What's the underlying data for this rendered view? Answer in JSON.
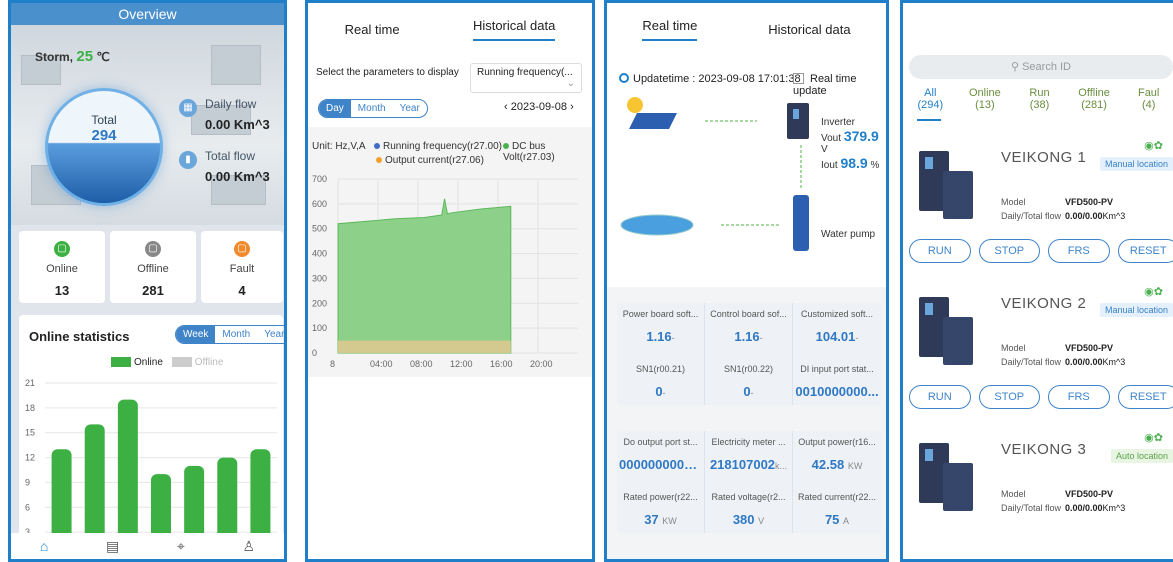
{
  "overview": {
    "title": "Overview",
    "weather": {
      "city": "Storm,",
      "temp": "25",
      "unit": "℃"
    },
    "total": {
      "label": "Total",
      "value": "294"
    },
    "daily_flow": {
      "label": "Daily flow",
      "value": "0.00 Km^3"
    },
    "total_flow": {
      "label": "Total flow",
      "value": "0.00 Km^3"
    },
    "stats": [
      {
        "label": "Online",
        "value": "13",
        "color": "#3cb043"
      },
      {
        "label": "Offline",
        "value": "281",
        "color": "#888888"
      },
      {
        "label": "Fault",
        "value": "4",
        "color": "#f08a2c"
      }
    ],
    "online_stats": {
      "title": "Online statistics",
      "ranges": [
        "Week",
        "Month",
        "Year"
      ],
      "legend": {
        "online": "Online",
        "offline": "Offline"
      },
      "chart_data": {
        "type": "bar",
        "values": [
          13,
          16,
          19,
          10,
          11,
          12,
          13
        ],
        "yticks": [
          "21",
          "18",
          "15",
          "12",
          "9",
          "6",
          "3"
        ],
        "ylim": [
          0,
          21
        ],
        "series": [
          {
            "name": "Online",
            "values": [
              13,
              16,
              19,
              10,
              11,
              12,
              13
            ]
          }
        ],
        "color": "#3cb043"
      }
    }
  },
  "historical": {
    "tabs": [
      "Real time",
      "Historical data"
    ],
    "select_label": "Select the parameters to display",
    "select_value": "Running frequency(...",
    "ranges": [
      "Day",
      "Month",
      "Year"
    ],
    "date": "2023-09-08",
    "unit": "Unit: Hz,V,A",
    "legend": [
      {
        "label": "Running frequency(r27.00)",
        "color": "#3f6cc9"
      },
      {
        "label": "DC bus Volt(r27.03)",
        "color": "#4cb050"
      },
      {
        "label": "Output current(r27.06)",
        "color": "#f0a02c"
      }
    ],
    "chart_data": {
      "type": "area",
      "xticks": [
        "8",
        "04:00",
        "08:00",
        "12:00",
        "16:00",
        "20:00"
      ],
      "yticks": [
        "700",
        "600",
        "500",
        "400",
        "300",
        "200",
        "100",
        "0"
      ],
      "ylim": [
        0,
        700
      ],
      "series": [
        {
          "name": "DC bus Volt(r27.03)",
          "x": [
            0,
            1,
            2,
            3,
            3.6,
            3.7,
            3.8,
            4,
            5,
            6
          ],
          "values": [
            520,
            530,
            540,
            545,
            555,
            620,
            560,
            565,
            580,
            590
          ]
        },
        {
          "name": "Output current(r27.06)",
          "x": [
            0,
            6
          ],
          "values": [
            50,
            50
          ]
        }
      ]
    }
  },
  "realtime": {
    "tabs": [
      "Real time",
      "Historical data"
    ],
    "updatetime": "Updatetime : 2023-09-08 17:01:38",
    "realtime_update": "Real time update",
    "inverter": {
      "label": "Inverter",
      "vout_label": "Vout",
      "vout": "379.9",
      "vout_unit": "V",
      "iout_label": "Iout",
      "iout": "98.9",
      "iout_unit": "%"
    },
    "pump_label": "Water pump",
    "params": [
      {
        "k": "Power board soft...",
        "v": "1.16",
        "u": "-"
      },
      {
        "k": "Control board sof...",
        "v": "1.16",
        "u": "-"
      },
      {
        "k": "Customized soft...",
        "v": "104.01",
        "u": "-"
      },
      {
        "k": "SN1(r00.21)",
        "v": "0",
        "u": "-"
      },
      {
        "k": "SN1(r00.22)",
        "v": "0",
        "u": "-"
      },
      {
        "k": "DI input port stat...",
        "v": "0010000000...",
        "u": ""
      },
      {
        "k": "Do output port st...",
        "v": "0000000000...",
        "u": ""
      },
      {
        "k": "Electricity meter ...",
        "v": "218107002",
        "u": "k..."
      },
      {
        "k": "Output power(r16...",
        "v": "42.58",
        "u": "KW"
      },
      {
        "k": "Rated power(r22...",
        "v": "37",
        "u": "KW"
      },
      {
        "k": "Rated voltage(r2...",
        "v": "380",
        "u": "V"
      },
      {
        "k": "Rated current(r22...",
        "v": "75",
        "u": "A"
      }
    ]
  },
  "devices": {
    "search_placeholder": "Search ID",
    "filters": [
      {
        "label": "All",
        "count": "(294)"
      },
      {
        "label": "Online",
        "count": "(13)"
      },
      {
        "label": "Run",
        "count": "(38)"
      },
      {
        "label": "Offline",
        "count": "(281)"
      },
      {
        "label": "Faul",
        "count": "(4)"
      }
    ],
    "model_label": "Model",
    "flow_label": "Daily/Total flow",
    "items": [
      {
        "name": "VEIKONG 1",
        "location": "Manual location",
        "model": "VFD500-PV",
        "flow": "0.00/0.00",
        "flow_unit": "Km^3"
      },
      {
        "name": "VEIKONG 2",
        "location": "Manual location",
        "model": "VFD500-PV",
        "flow": "0.00/0.00",
        "flow_unit": "Km^3"
      },
      {
        "name": "VEIKONG 3",
        "location": "Auto location",
        "model": "VFD500-PV",
        "flow": "0.00/0.00",
        "flow_unit": "Km^3"
      }
    ],
    "actions": [
      "RUN",
      "STOP",
      "FRS",
      "RESET"
    ]
  }
}
